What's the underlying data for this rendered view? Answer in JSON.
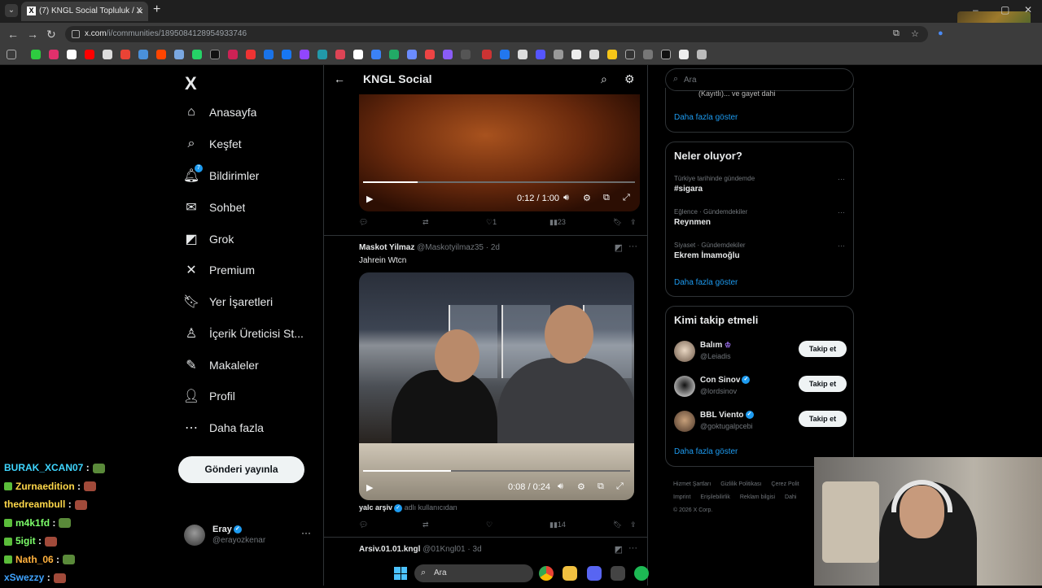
{
  "browser": {
    "tab_title": "(7) KNGL Social Topluluk / X",
    "tab_favicon": "X",
    "url_host": "x.com",
    "url_path": "/i/communities/1895084128954933746",
    "icons": [
      "tab-list-icon",
      "close-icon",
      "new-tab-icon",
      "back-icon",
      "forward-icon",
      "reload-icon",
      "install-icon",
      "star-icon"
    ]
  },
  "nav": {
    "logo": "X",
    "items": [
      {
        "label": "Anasayfa",
        "icon": "home-icon",
        "glyph": "⌂"
      },
      {
        "label": "Keşfet",
        "icon": "search-icon",
        "glyph": "⌕"
      },
      {
        "label": "Bildirimler",
        "icon": "bell-icon",
        "glyph": "🔔︎",
        "badge": "7"
      },
      {
        "label": "Sohbet",
        "icon": "mail-icon",
        "glyph": "✉"
      },
      {
        "label": "Grok",
        "icon": "grok-icon",
        "glyph": "◩"
      },
      {
        "label": "Premium",
        "icon": "x-premium-icon",
        "glyph": "✕"
      },
      {
        "label": "Yer İşaretleri",
        "icon": "bookmark-icon",
        "glyph": "🔖︎"
      },
      {
        "label": "İçerik Üreticisi St...",
        "icon": "creator-studio-icon",
        "glyph": "♙"
      },
      {
        "label": "Makaleler",
        "icon": "articles-icon",
        "glyph": "✎"
      },
      {
        "label": "Profil",
        "icon": "profile-icon",
        "glyph": "👤︎"
      },
      {
        "label": "Daha fazla",
        "icon": "more-circle-icon",
        "glyph": "⋯"
      }
    ],
    "post_button": "Gönderi yayınla",
    "account": {
      "name": "Eray",
      "handle": "@erayozkenar",
      "more": "···"
    }
  },
  "main": {
    "title": "KNGL Social",
    "back_glyph": "←",
    "video1": {
      "time": "0:12 / 1:00",
      "progress": 0.2
    },
    "post1_actions": {
      "reply": "",
      "repost": "",
      "like": "1",
      "views": "23"
    },
    "post2": {
      "name": "Maskot Yilmaz",
      "handle": "@Maskotyilmaz35",
      "time": "· 2d",
      "text": "Jahrein Wtcn",
      "video_time": "0:08 / 0:24",
      "progress": 0.33,
      "caption_name": "yalc arşiv",
      "caption_rest": "adlı kullanıcıdan",
      "actions": {
        "reply": "",
        "repost": "",
        "like": "",
        "views": "14"
      }
    },
    "post3": {
      "name": "Arsiv.01.01.kngl",
      "handle": "@01Kngl01",
      "time": "· 3d"
    }
  },
  "sidebar": {
    "search_placeholder": "Ara",
    "top_card_cut": "(Kayıtlı)... ve gayet dahi",
    "top_show_more": "Daha fazla göster",
    "trends_title": "Neler oluyor?",
    "trends": [
      {
        "context": "Türkiye tarihinde gündemde",
        "name": "#sigara"
      },
      {
        "context": "Eğlence · Gündemdekiler",
        "name": "Reynmen"
      },
      {
        "context": "Siyaset · Gündemdekiler",
        "name": "Ekrem İmamoğlu"
      }
    ],
    "trends_show_more": "Daha fazla göster",
    "who_title": "Kimi takip etmeli",
    "who": [
      {
        "name": "Balım",
        "handle": "@Leiadis",
        "follow": "Takip et",
        "color": "#d9c8b6",
        "badge": "purple"
      },
      {
        "name": "Con Sinov",
        "handle": "@lordsinov",
        "follow": "Takip et",
        "color": "#f0f0f0",
        "badge": "blue"
      },
      {
        "name": "BBL Viento",
        "handle": "@goktugalpcebi",
        "follow": "Takip et",
        "color": "#8a6a50",
        "badge": "blue"
      }
    ],
    "who_show_more": "Daha fazla göster",
    "footer": [
      "Hizmet Şartları",
      "Gizlilik Politikası",
      "Çerez Polit",
      "Imprint",
      "Erişilebilirlik",
      "Reklam bilgisi",
      "Dahi",
      "© 2026 X Corp."
    ]
  },
  "chat": [
    {
      "user": "BURAK_XCAN07",
      "color": "#3fd6ff",
      "badge": false,
      "emote": "#5a8a3a"
    },
    {
      "user": "Zurnaedition",
      "color": "#ffd84a",
      "badge": true,
      "emote": "#a14a3a"
    },
    {
      "user": "thedreambull",
      "color": "#ffd84a",
      "badge": false,
      "emote": "#a14a3a"
    },
    {
      "user": "m4k1fd",
      "color": "#7dff6a",
      "badge": true,
      "emote": "#5a8a3a"
    },
    {
      "user": "5igit",
      "color": "#7dff6a",
      "badge": true,
      "emote": "#a14a3a"
    },
    {
      "user": "Nath_06",
      "color": "#ffb13d",
      "badge": true,
      "emote": "#5a8a3a"
    },
    {
      "user": "xSwezzy",
      "color": "#3fa3ff",
      "badge": false,
      "emote": "#a14a3a"
    }
  ],
  "taskbar": {
    "search_placeholder": "Ara",
    "apps": [
      "#e8b93a",
      "#f0c040",
      "#5865f2",
      "#444",
      "#1db954"
    ]
  }
}
